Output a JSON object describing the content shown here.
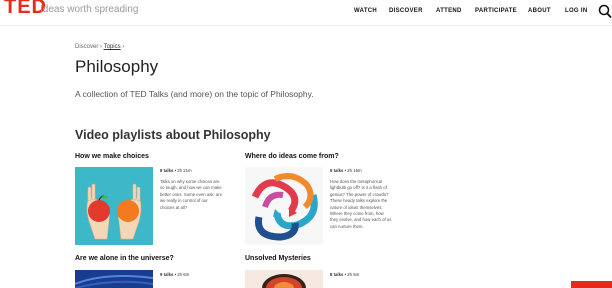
{
  "header": {
    "logo": "TED",
    "tagline": "Ideas worth spreading",
    "nav": [
      "WATCH",
      "DISCOVER",
      "ATTEND",
      "PARTICIPATE",
      "ABOUT",
      "LOG IN"
    ]
  },
  "breadcrumb": {
    "discover": "Discover",
    "sep1": "›",
    "topics": "Topics",
    "sep2": "›"
  },
  "page": {
    "title": "Philosophy",
    "description": "A collection of TED Talks (and more) on the topic of Philosophy.",
    "section_title": "Video playlists about Philosophy"
  },
  "playlists": [
    {
      "title": "How we make choices",
      "count": "8 talks",
      "duration": " • 2h 21m",
      "desc": [
        "Talks on why some choices are",
        "so tough, and how we can make",
        "better ones. Some even ask: are",
        "we really in control of our",
        "choices at all?"
      ]
    },
    {
      "title": "Where do ideas come from?",
      "count": "9 talks",
      "duration": " • 2h 16m",
      "desc": [
        "How does the metaphorical",
        "lightbulb go off? Is it a flash of",
        "genius? The power of crowds?",
        "These heady talks explore the",
        "nature of ideas themselves:",
        "Where they come from, how",
        "they evolve, and how each of us",
        "can nurture them."
      ]
    },
    {
      "title": "Are we alone in the universe?",
      "count": "9 talks",
      "duration": " • 2h 6m"
    },
    {
      "title": "Unsolved Mysteries",
      "count": "8 talks",
      "duration": " • 2h 5m"
    }
  ],
  "colors": {
    "brand": "#e62b1e"
  }
}
